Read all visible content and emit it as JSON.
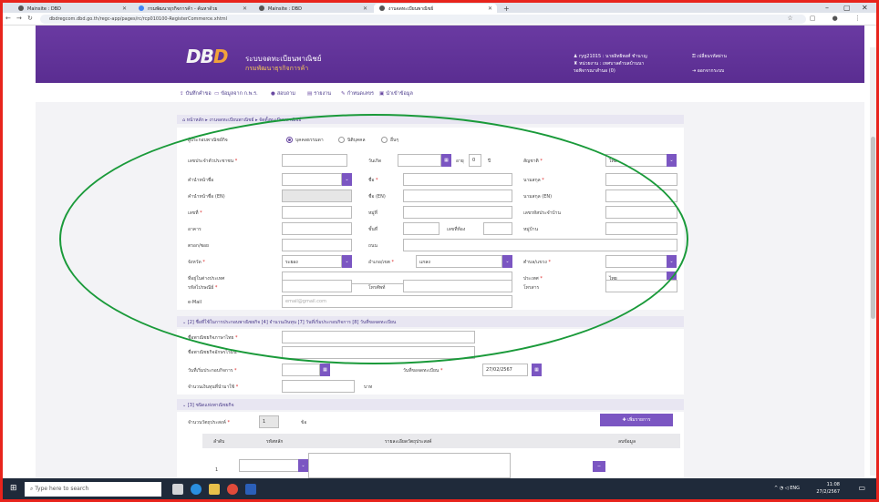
{
  "browser": {
    "tabs": [
      {
        "label": "Mainsite : DBD"
      },
      {
        "label": "กรมพัฒนาธุรกิจการค้า - ค้นหาด้วย"
      },
      {
        "label": "Mainsite : DBD"
      },
      {
        "label": "งานจดทะเบียนพาณิชย์"
      }
    ],
    "url": "dbdregcom.dbd.go.th/regc-app/pages/rc/rcp010100-RegisterCommerce.xhtml"
  },
  "header": {
    "logo_main": "DB",
    "logo_accent": "D",
    "brand_line1": "ระบบจดทะเบียนพาณิชย์",
    "brand_line2": "กรมพัฒนาธุรกิจการค้า",
    "user_line": "ryg21015 : นายอิทธิพงศ์ ชำนาญ",
    "change_password": "เปลี่ยนรหัสผ่าน",
    "unit_line": "หน่วยงาน : เทศบาลตำบลบ้านนา",
    "pending": "รอพิจารณาสำนอ (0)",
    "logout": "ออกจากระบบ"
  },
  "menu": [
    {
      "label": "บันทึกคำขอ"
    },
    {
      "label": "ข้อมูลจาก ก.พ.ร."
    },
    {
      "label": "สอบถาม"
    },
    {
      "label": "รายงาน"
    },
    {
      "label": "กำหนดเลขร"
    },
    {
      "label": "นำเข้าข้อมูล"
    }
  ],
  "breadcrumb": "หน้าหลัก ▸ งานจดทะเบียนพาณิชย์ ▸ จัดตั้งทะเบียนพาณิชย์",
  "form": {
    "business_type_label": "ผู้ประกอบพาณิชย์กิจ",
    "radio_options": [
      "บุคคลธรรมดา",
      "นิติบุคคล",
      "อื่นๆ"
    ],
    "id_label": "เลขประจำตัวประชาชน",
    "birth_label": "วันเกิด",
    "age_label": "อายุ",
    "age_value": "0",
    "age_unit": "ปี",
    "nationality_label": "สัญชาติ",
    "nationality_value": "ไทย",
    "prefix_label": "คำนำหน้าชื่อ",
    "name_label": "ชื่อ",
    "surname_label": "นามสกุล",
    "prefix_en_label": "คำนำหน้าชื่อ (EN)",
    "name_en_label": "ชื่อ (EN)",
    "surname_en_label": "นามสกุล (EN)",
    "house_no_label": "เลขที่",
    "moo_label": "หมู่ที่",
    "house_id_label": "เลขรหัสประจำบ้าน",
    "building_label": "อาคาร",
    "floor_label": "ชั้นที่",
    "room_label": "เลขที่ห้อง",
    "village_label": "หมู่บ้าน",
    "soi_label": "ตรอก/ซอย",
    "road_label": "ถนน",
    "province_label": "จังหวัด",
    "province_value": "ระยอง",
    "district_label": "อำเภอ/เขต",
    "district_value": "แกลง",
    "subdistrict_label": "ตำบล/แขวง",
    "foreign_addr_label": "ที่อยู่ในต่างประเทศ",
    "country_label": "ประเทศ",
    "country_value": "ไทย",
    "postcode_label": "รหัสไปรษณีย์",
    "phone_label": "โทรศัพท์",
    "fax_label": "โทรสาร",
    "email_label": "e-Mail",
    "email_placeholder": "email@gmail.com"
  },
  "section2": {
    "title": "[2] ชื่อที่ใช้ในการประกอบพาณิชยกิจ [4] จำนวนเงินทุน [7] วันที่เริ่มประกอบกิจการ [8] วันที่ขอจดทะเบียน",
    "thai_name_label": "ชื่อพาณิชยกิจภาษาไทย",
    "eng_name_label": "ชื่อพาณิชยกิจอักษรโรมัน",
    "start_date_label": "วันที่เริ่มประกอบกิจการ",
    "reg_date_label": "วันที่ขอจดทะเบียน",
    "reg_date_value": "27/02/2567",
    "capital_label": "จำนวนเงินทุนที่นำมาใช้",
    "capital_unit": "บาท"
  },
  "section3": {
    "title": "[3] ชนิดแห่งพาณิชยกิจ",
    "count_label": "จำนวนวัตถุประสงค์",
    "count_value": "1",
    "count_unit": "ข้อ",
    "add_button": "เพิ่มรายการ",
    "columns": [
      "ลำดับ",
      "รหัสหลัก",
      "รายละเอียดวัตถุประสงค์",
      "ลบข้อมูล"
    ],
    "row_index": "1"
  },
  "taskbar": {
    "search_placeholder": "Type here to search",
    "time": "11:08",
    "date": "27/2/2567",
    "lang": "ENG"
  },
  "colors": {
    "brand_purple": "#5a2d91",
    "accent_orange": "#f2a33a",
    "highlight_oval": "#1a9a3a",
    "frame_red": "#e8241c"
  }
}
